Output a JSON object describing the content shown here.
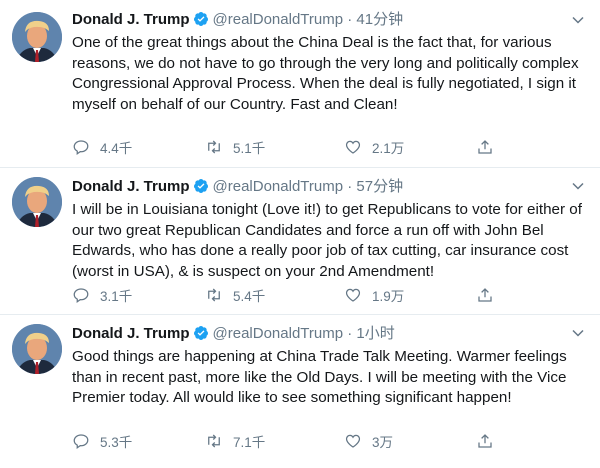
{
  "accent": "#1da1f2",
  "icons": {
    "reply": "reply-icon",
    "retweet": "retweet-icon",
    "like": "heart-icon",
    "share": "share-icon",
    "verified": "verified-badge-icon",
    "caret": "chevron-down-icon"
  },
  "tweets": [
    {
      "name": "Donald J. Trump",
      "handle": "@realDonaldTrump",
      "dot": "·",
      "time": "41分钟",
      "text": "One of the great things about the China Deal is the fact that, for various reasons, we do not have to go through the very long and politically complex Congressional Approval Process. When the deal is fully negotiated, I sign it myself on behalf of our Country. Fast and Clean!",
      "replies": "4.4千",
      "retweets": "5.1千",
      "likes": "2.1万"
    },
    {
      "name": "Donald J. Trump",
      "handle": "@realDonaldTrump",
      "dot": "·",
      "time": "57分钟",
      "text": "I will be in Louisiana tonight (Love it!) to get Republicans to vote for either of our two great Republican Candidates and force a run off with John Bel Edwards, who has done a really poor job of tax cutting, car insurance cost (worst in USA), & is suspect on your 2nd Amendment!",
      "replies": "3.1千",
      "retweets": "5.4千",
      "likes": "1.9万"
    },
    {
      "name": "Donald J. Trump",
      "handle": "@realDonaldTrump",
      "dot": "·",
      "time": "1小时",
      "text": "Good things are happening at China Trade Talk Meeting. Warmer feelings than in recent past, more like the Old Days. I will be meeting with the Vice Premier today. All would like to see something significant happen!",
      "replies": "5.3千",
      "retweets": "7.1千",
      "likes": "3万"
    }
  ]
}
